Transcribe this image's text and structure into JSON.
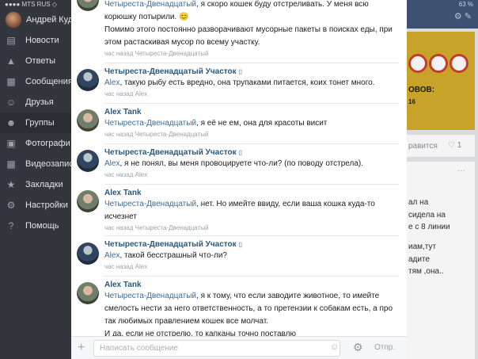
{
  "status": {
    "carrier": "●●●● MTS RUS ◇",
    "battery": "63 %"
  },
  "sidebar": {
    "user_name": "Андрей Куд",
    "items": [
      {
        "label": "Новости",
        "icon": "newspaper-icon"
      },
      {
        "label": "Ответы",
        "icon": "bell-icon"
      },
      {
        "label": "Сообщения",
        "icon": "chat-bubbles-icon"
      },
      {
        "label": "Друзья",
        "icon": "person-icon"
      },
      {
        "label": "Группы",
        "icon": "people-icon"
      },
      {
        "label": "Фотографи",
        "icon": "camera-icon"
      },
      {
        "label": "Видеозапис",
        "icon": "film-icon"
      },
      {
        "label": "Закладки",
        "icon": "star-icon"
      },
      {
        "label": "Настройки",
        "icon": "gear-icon"
      },
      {
        "label": "Помощь",
        "icon": "help-icon"
      }
    ]
  },
  "background_feed": {
    "card_text_1": "ОВОВ:",
    "card_text_2": "16",
    "like_strip_a": "равится",
    "like_count": "1",
    "post_lines": [
      "ал на",
      "сидела на",
      "е с 8 линии",
      "иам,тут",
      "адите",
      "тям ,она.."
    ]
  },
  "chat": {
    "messages": [
      {
        "author": "",
        "body_prefix": "",
        "body_parts": [
          {
            "mention": "Четыреста-Двенадцатый",
            "text": ", я скоро кошек буду отстреливать. У меня всю корюшку потырили. 😊"
          },
          {
            "mention": "",
            "text": "Помимо этого постоянно разворачивают мусорные пакеты в поисках еды, при этом растаскивая мусор по всему участку."
          }
        ],
        "time": "час назад Четыреста-Двенадцатый"
      },
      {
        "author": "Четыреста-Двенадцатый Участок",
        "mention": "Alex",
        "text": ", такую рыбу есть вредно, она трупаками питается, коих тонет много.",
        "time": "час назад Alex"
      },
      {
        "author": "Alex Tank",
        "mention": "Четыреста-Двенадцатый",
        "text": ", я её не ем, она для красоты висит",
        "time": "час назад Четыреста-Двенадцатый"
      },
      {
        "author": "Четыреста-Двенадцатый Участок",
        "mention": "Alex",
        "text": ", я не понял, вы меня провоцируете что-ли? (по поводу отстрела).",
        "time": "час назад Alex"
      },
      {
        "author": "Alex Tank",
        "mention": "Четыреста-Двенадцатый",
        "text": ", нет. Но имейте ввиду, если ваша кошка куда-то исчезнет",
        "time": "час назад Четыреста-Двенадцатый"
      },
      {
        "author": "Четыреста-Двенадцатый Участок",
        "mention": "Alex",
        "text": ", такой бесстрашный что-ли?",
        "time": "час назад Alex"
      },
      {
        "author": "Alex Tank",
        "mention": "Четыреста-Двенадцатый",
        "text": ", я к тому, что если заводите животное, то имейте смелость нести за него ответственность, а то претензии к собакам есть, а про так любимых правлением кошек все молчат.",
        "text2": "И да, если не отстрелю, то капканы точно поставлю"
      }
    ]
  },
  "input": {
    "placeholder": "Написать сообщение",
    "value": "",
    "send_label": "Отпр."
  },
  "colors": {
    "sidebar_bg": "#33373d",
    "link": "#2b587a",
    "mention": "#3d6c98"
  }
}
